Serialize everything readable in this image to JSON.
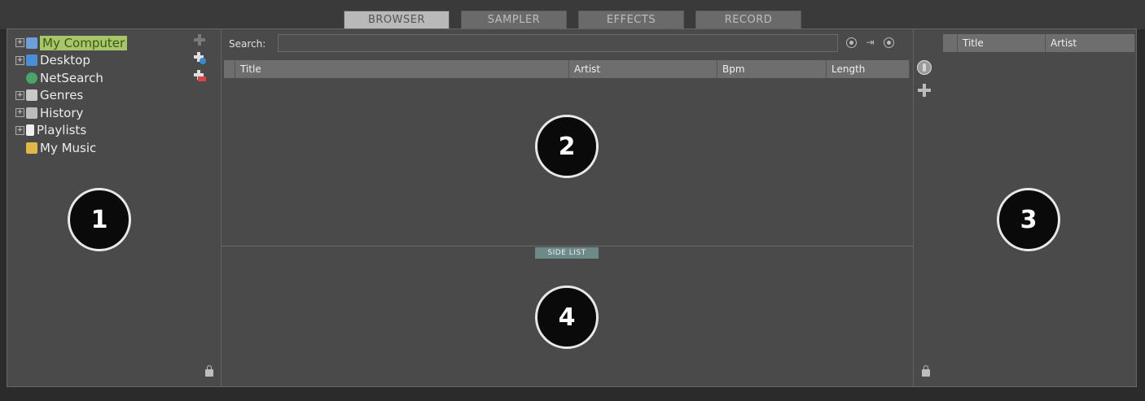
{
  "tabs": [
    {
      "label": "BROWSER",
      "active": true
    },
    {
      "label": "SAMPLER",
      "active": false
    },
    {
      "label": "EFFECTS",
      "active": false
    },
    {
      "label": "RECORD",
      "active": false
    }
  ],
  "tree": {
    "items": [
      {
        "label": "My Computer",
        "expandable": true,
        "icon": "computer-icon",
        "selected": true
      },
      {
        "label": "Desktop",
        "expandable": true,
        "icon": "desktop-icon"
      },
      {
        "label": "NetSearch",
        "expandable": false,
        "icon": "globe-icon"
      },
      {
        "label": "Genres",
        "expandable": true,
        "icon": "stack-icon"
      },
      {
        "label": "History",
        "expandable": true,
        "icon": "book-icon"
      },
      {
        "label": "Playlists",
        "expandable": true,
        "icon": "document-icon"
      },
      {
        "label": "My Music",
        "expandable": false,
        "icon": "folder-icon"
      }
    ]
  },
  "search": {
    "label": "Search:",
    "value": "",
    "placeholder": ""
  },
  "columns": [
    "Title",
    "Artist",
    "Bpm",
    "Length"
  ],
  "side_list": {
    "label": "SIDE LIST",
    "columns": [
      "Title",
      "Artist"
    ]
  },
  "markers": [
    "1",
    "2",
    "3",
    "4"
  ],
  "colors": {
    "selected_bg": "#a8c56b",
    "marker_bg": "#0a0a0a",
    "panel_bg": "#4a4a4a"
  }
}
